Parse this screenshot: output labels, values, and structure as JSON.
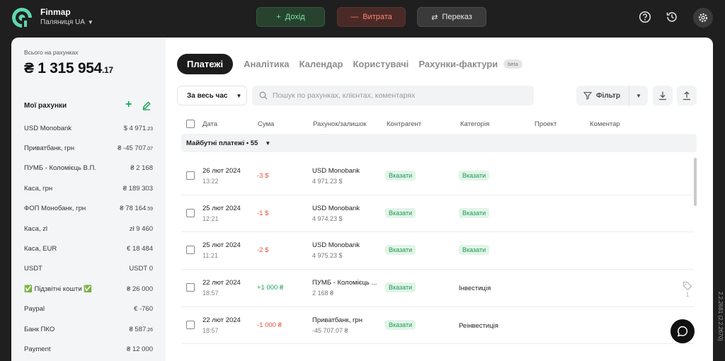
{
  "app": {
    "name": "Finmap",
    "company": "Паляниця UA"
  },
  "toolbar": {
    "income_label": "Дохід",
    "expense_label": "Витрата",
    "transfer_label": "Переказ",
    "icons": [
      "help-icon",
      "history-icon",
      "settings-icon"
    ]
  },
  "sidebar": {
    "total_label": "Всього на рахунках",
    "total_main": "₴ 1 315 954",
    "total_cents": ".17",
    "accounts_title": "Мої рахунки",
    "add_symbol": "+",
    "accounts": [
      {
        "name": "USD Monobank",
        "amount": "$ 4 971",
        "cents": ".23"
      },
      {
        "name": "Приватбанк, грн",
        "amount": "₴ -45 707",
        "cents": ".07"
      },
      {
        "name": "ПУМБ - Коломієць В.П.",
        "amount": "₴ 2 168",
        "cents": ""
      },
      {
        "name": "Каса, грн",
        "amount": "₴ 189 303",
        "cents": ""
      },
      {
        "name": "ФОП Монобанк, грн",
        "amount": "₴ 78 164",
        "cents": ".59"
      },
      {
        "name": "Каса, zl",
        "amount": "zł 9 460",
        "cents": ""
      },
      {
        "name": "Каса, EUR",
        "amount": "€ 18 484",
        "cents": ""
      },
      {
        "name": "USDT",
        "amount": "USDT 0",
        "cents": ""
      },
      {
        "name": "✅ Підзвітні кошти ✅",
        "amount": "₴ 26 000",
        "cents": ""
      },
      {
        "name": "Paypal",
        "amount": "€ -760",
        "cents": ""
      },
      {
        "name": "Банк ПКО",
        "amount": "₴ 587",
        "cents": ".26"
      },
      {
        "name": "Payment",
        "amount": "₴ 12 000",
        "cents": ""
      }
    ]
  },
  "main": {
    "tabs": [
      "Платежі",
      "Аналітика",
      "Календар",
      "Користувачі",
      "Рахунки-фактури"
    ],
    "beta_label": "beta",
    "period_label": "За весь час",
    "search_placeholder": "Пошук по рахунках, клієнтах, коментарях",
    "filter_label": "Фільтр",
    "columns": [
      "Дата",
      "Сума",
      "Рахунок/залишок",
      "Контрагент",
      "Категорія",
      "Проект",
      "Коментар"
    ],
    "group_label": "Майбутні платежі • 55",
    "rows": [
      {
        "date": "26 лют 2024",
        "time": "13:22",
        "sum": "-3  $",
        "sign": "neg",
        "account": "USD Monobank",
        "balance": "4 971.23  $",
        "counterparty": "Вказати",
        "category": "Вказати",
        "category_is_badge": true,
        "tag": false
      },
      {
        "date": "25 лют 2024",
        "time": "12:21",
        "sum": "-1  $",
        "sign": "neg",
        "account": "USD Monobank",
        "balance": "4 974.23  $",
        "counterparty": "Вказати",
        "category": "Вказати",
        "category_is_badge": true,
        "tag": false
      },
      {
        "date": "25 лют 2024",
        "time": "11:21",
        "sum": "-2  $",
        "sign": "neg",
        "account": "USD Monobank",
        "balance": "4 975.23  $",
        "counterparty": "Вказати",
        "category": "Вказати",
        "category_is_badge": true,
        "tag": false
      },
      {
        "date": "22 лют 2024",
        "time": "18:57",
        "sum": "+1 000  ₴",
        "sign": "pos",
        "account": "ПУМБ - Коломієць ...",
        "balance": "2 168  ₴",
        "counterparty": "Вказати",
        "category": "Інвестиція",
        "category_is_badge": false,
        "tag": true,
        "tag_count": "1"
      },
      {
        "date": "22 лют 2024",
        "time": "18:57",
        "sum": "-1 000  ₴",
        "sign": "neg",
        "account": "Приватбанк, грн",
        "balance": "-45 707.07  ₴",
        "counterparty": "Вказати",
        "category": "Реінвестиція",
        "category_is_badge": false,
        "tag": false
      }
    ]
  },
  "version": "2.2.2681 (2.2.2670)"
}
